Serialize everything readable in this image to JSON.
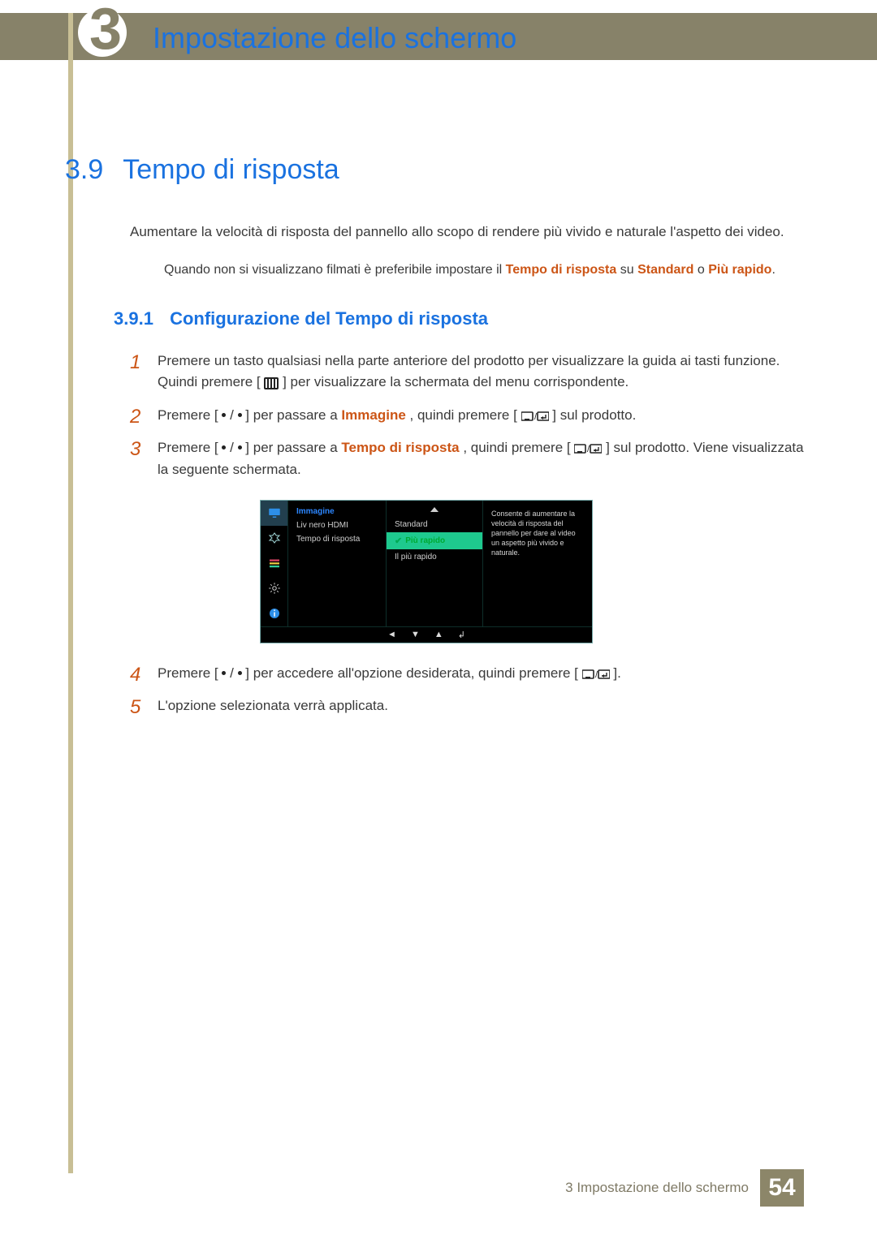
{
  "chapter": {
    "number": "3",
    "title": "Impostazione dello schermo"
  },
  "section": {
    "number": "3.9",
    "title": "Tempo di risposta",
    "intro": "Aumentare la velocità di risposta del pannello allo scopo di rendere più vivido e naturale l'aspetto dei video.",
    "note_pre": "Quando non si visualizzano filmati è preferibile impostare il ",
    "note_hw1": "Tempo di risposta",
    "note_mid1": " su ",
    "note_hw2": "Standard",
    "note_mid2": " o ",
    "note_hw3": "Più rapido",
    "note_post": "."
  },
  "subsection": {
    "number": "3.9.1",
    "title": "Configurazione del Tempo di risposta"
  },
  "steps": {
    "s1a": "Premere un tasto qualsiasi nella parte anteriore del prodotto per visualizzare la guida ai tasti funzione. Quindi premere [",
    "s1b": "] per visualizzare la schermata del menu corrispondente.",
    "s2a": "Premere [",
    "s2slash": " / ",
    "s2b": "] per passare a ",
    "s2hw": "Immagine",
    "s2c": ", quindi premere [",
    "s2d": "] sul prodotto.",
    "s3a": "Premere [",
    "s3b": "] per passare a ",
    "s3hw": "Tempo di risposta",
    "s3c": ", quindi premere [",
    "s3d": "] sul prodotto. Viene visualizzata la seguente schermata.",
    "s4a": "Premere [",
    "s4b": "] per accedere all'opzione desiderata, quindi premere [",
    "s4c": "].",
    "s5": "L'opzione selezionata verrà applicata."
  },
  "osd": {
    "menu_title": "Immagine",
    "item1": "Liv nero HDMI",
    "item2": "Tempo di risposta",
    "opt1": "Standard",
    "opt2": "Più rapido",
    "opt3": "Il più rapido",
    "desc": "Consente di aumentare la velocità di risposta del pannello per dare al video un aspetto più vivido e naturale."
  },
  "footer": {
    "text": "3 Impostazione dello schermo",
    "page": "54"
  }
}
